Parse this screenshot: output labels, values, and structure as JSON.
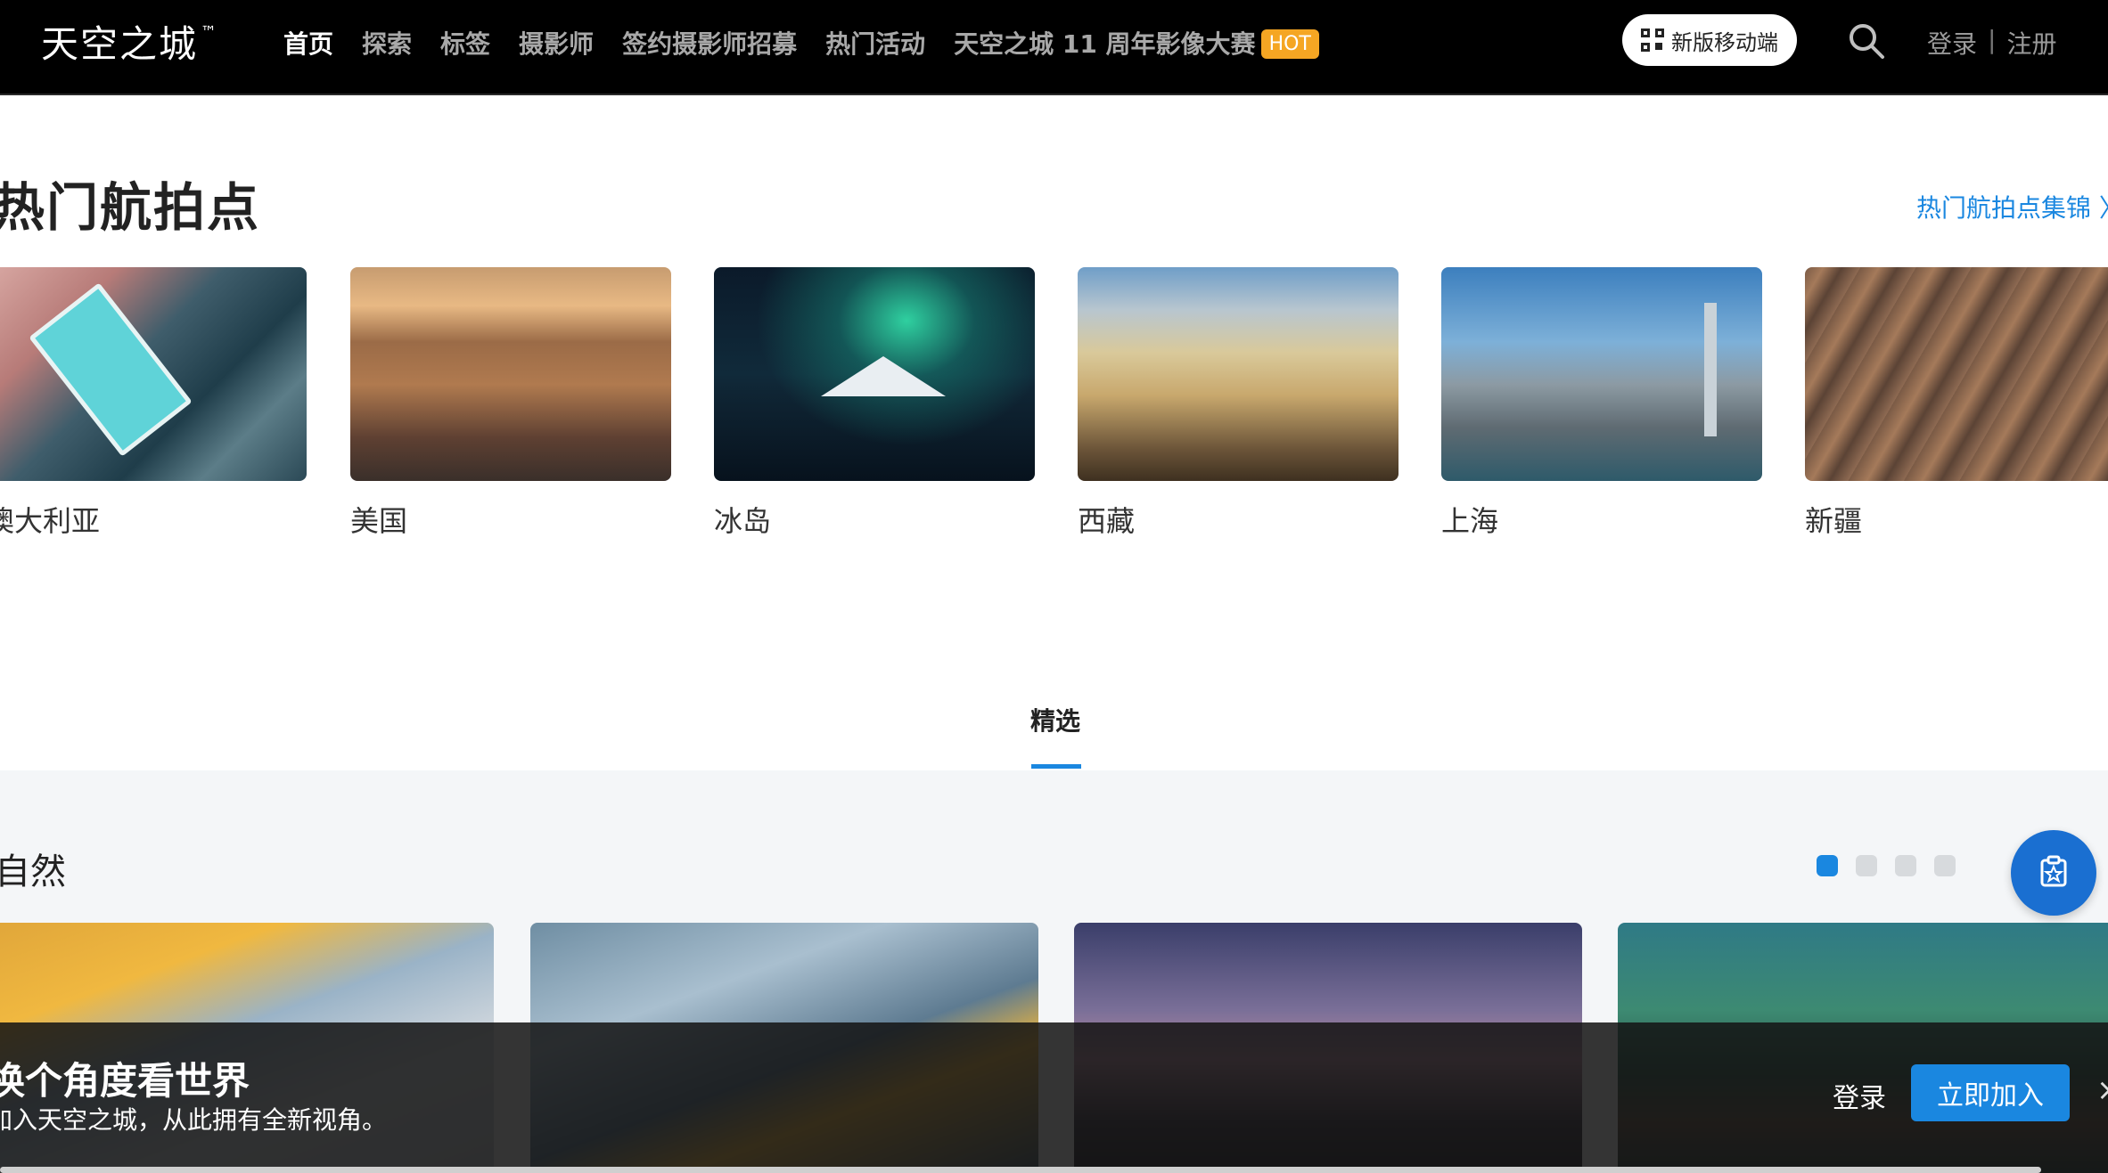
{
  "header": {
    "brand": "天空之城",
    "brand_mark": "™",
    "nav": [
      {
        "label": "首页",
        "active": true
      },
      {
        "label": "探索"
      },
      {
        "label": "标签"
      },
      {
        "label": "摄影师"
      },
      {
        "label": "签约摄影师招募"
      },
      {
        "label": "热门活动"
      },
      {
        "label": "天空之城 11 周年影像大赛",
        "badge": "HOT"
      }
    ],
    "mobile_button": "新版移动端",
    "login": "登录",
    "separator": "|",
    "register": "注册"
  },
  "hot_spots": {
    "title": "热门航拍点",
    "collection_link": "热门航拍点集锦 〉",
    "items": [
      {
        "label": "澳大利亚"
      },
      {
        "label": "美国"
      },
      {
        "label": "冰岛"
      },
      {
        "label": "西藏"
      },
      {
        "label": "上海"
      },
      {
        "label": "新疆"
      }
    ]
  },
  "tabs": {
    "featured": "精选"
  },
  "nature": {
    "title": "自然",
    "page_count": 4,
    "active_page": 1
  },
  "promo": {
    "title": "换个角度看世界",
    "subtitle": "加入天空之城，从此拥有全新视角。",
    "login": "登录",
    "join": "立即加入",
    "close": "×"
  },
  "colors": {
    "accent": "#1a87e0",
    "hot_badge": "#f5a623",
    "nav_bg": "#000000"
  }
}
